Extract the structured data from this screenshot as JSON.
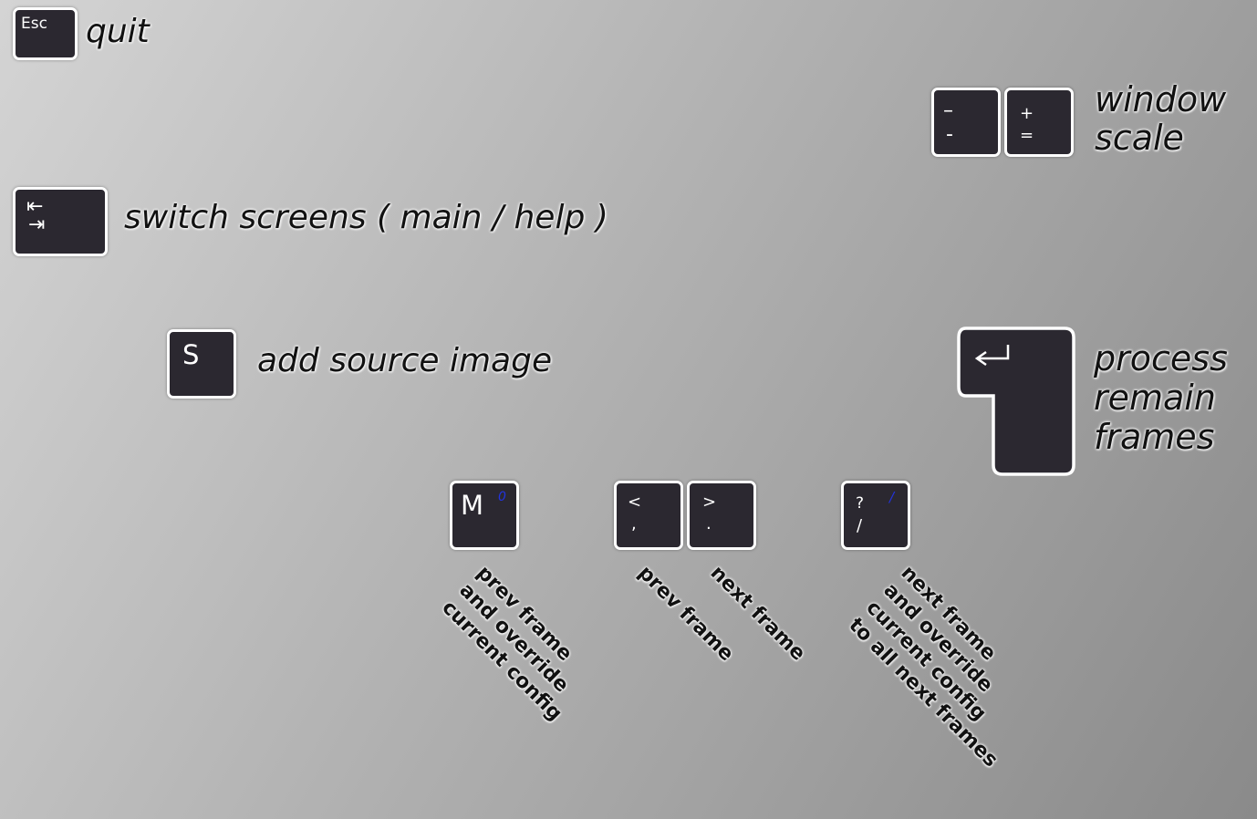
{
  "quit": {
    "key": "Esc",
    "label": "quit"
  },
  "window_scale": {
    "minus_key": {
      "top": "–",
      "bottom": "-"
    },
    "plus_key": {
      "top": "+",
      "bottom": "="
    },
    "label_line1": "window",
    "label_line2": "scale"
  },
  "switch_screens": {
    "key_top": "⇤",
    "key_bottom": "⇥",
    "label": "switch screens ( main / help )"
  },
  "add_source": {
    "key": "S",
    "label": "add source image"
  },
  "process": {
    "key_icon": "↵",
    "label_line1": "process",
    "label_line2": "remain",
    "label_line3": "frames"
  },
  "m_key": {
    "key": "M",
    "alt": "0",
    "lines": [
      "prev frame",
      "and override",
      "current config"
    ]
  },
  "prev_key": {
    "top": "<",
    "bottom": ",",
    "lines": [
      "prev frame"
    ]
  },
  "next_key": {
    "top": ">",
    "bottom": ".",
    "lines": [
      "next frame"
    ]
  },
  "slash_key": {
    "top": "?",
    "bottom": "/",
    "alt": "/",
    "lines": [
      "next frame",
      "and override",
      "current config",
      "to all next frames"
    ]
  },
  "colors": {
    "key_fill": "#2b2830",
    "key_border": "#ffffff",
    "alt_glyph": "#2233dd"
  }
}
